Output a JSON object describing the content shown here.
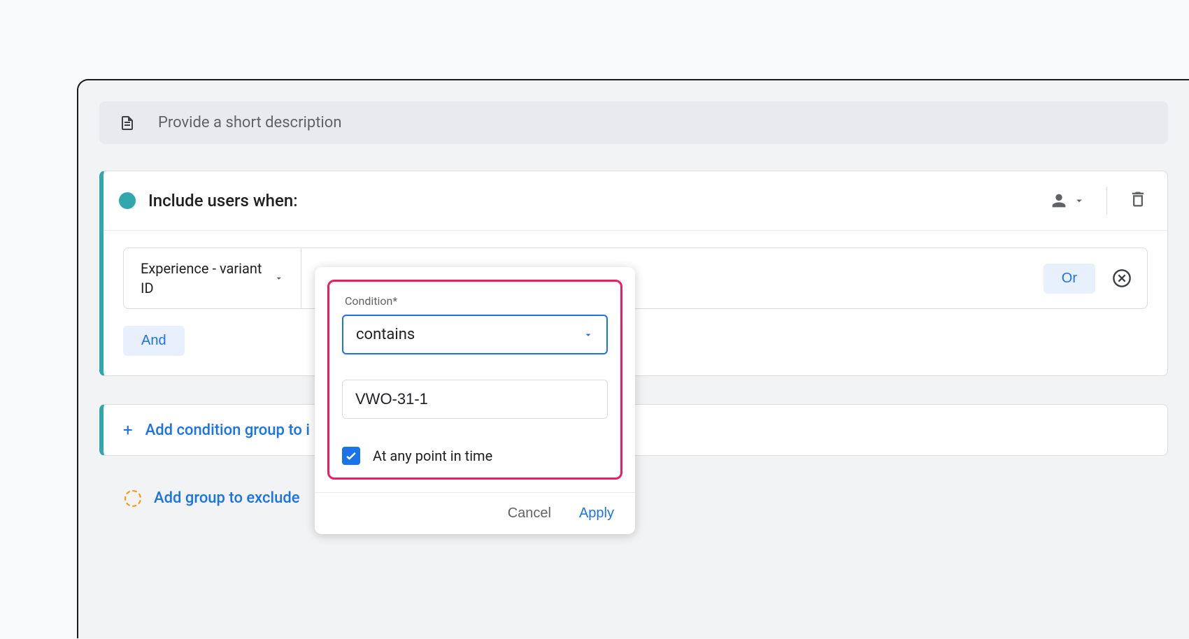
{
  "description": {
    "placeholder": "Provide a short description"
  },
  "include_group": {
    "title": "Include users when:",
    "dimension": "Experience - variant ID",
    "or_label": "Or",
    "and_label": "And"
  },
  "add_include": {
    "label": "Add condition group to i"
  },
  "add_exclude": {
    "label": "Add group to exclude"
  },
  "condition_popup": {
    "label": "Condition*",
    "operator": "contains",
    "value": "VWO-31-1",
    "checkbox_label": "At any point in time",
    "cancel": "Cancel",
    "apply": "Apply"
  }
}
